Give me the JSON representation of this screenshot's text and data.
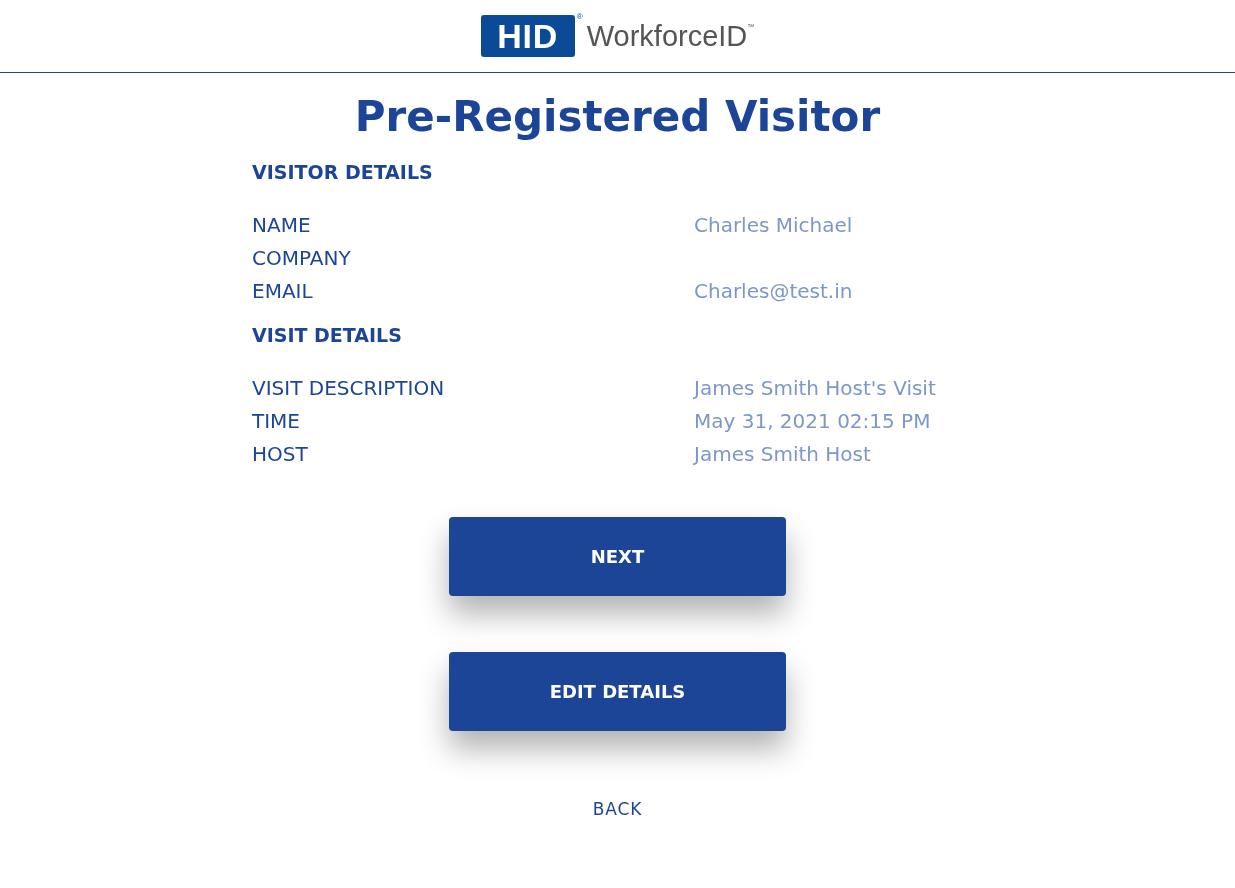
{
  "logo": {
    "mark": "HID",
    "registered": "®",
    "product": "WorkforceID",
    "trademark": "™"
  },
  "title": "Pre-Registered Visitor",
  "sections": [
    {
      "heading": "VISITOR DETAILS",
      "fields": [
        {
          "label": "NAME",
          "value": "Charles Michael"
        },
        {
          "label": "COMPANY"
        },
        {
          "label": "EMAIL",
          "value": "Charles@test.in"
        }
      ]
    },
    {
      "heading": "VISIT DETAILS",
      "fields": [
        {
          "label": "VISIT DESCRIPTION",
          "value": "James Smith Host's Visit"
        },
        {
          "label": "TIME",
          "value": "May 31, 2021 02:15 PM"
        },
        {
          "label": "HOST",
          "value": "James Smith Host"
        }
      ]
    }
  ],
  "buttons": [
    "NEXT",
    "EDIT DETAILS"
  ],
  "back_link": "BACK"
}
